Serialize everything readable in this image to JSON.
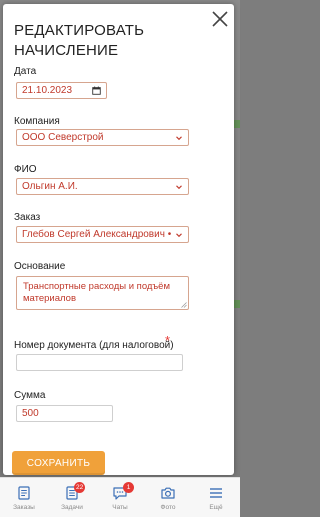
{
  "modal": {
    "title": "РЕДАКТИРОВАТЬ НАЧИСЛЕНИЕ",
    "close_icon": "close-icon"
  },
  "form": {
    "date": {
      "label": "Дата",
      "value": "21.10.2023",
      "icon": "calendar-icon"
    },
    "company": {
      "label": "Компания",
      "value": "ООО Северстрой",
      "icon": "chevron-down-icon"
    },
    "fio": {
      "label": "ФИО",
      "value": "Ольгин А.И.",
      "icon": "chevron-down-icon"
    },
    "order": {
      "label": "Заказ",
      "value": "Глебов Сергей Александрович •",
      "icon": "chevron-down-icon"
    },
    "basis": {
      "label": "Основание",
      "value": "Транспортные расходы и подъём материалов"
    },
    "doc_number": {
      "label": "Номер документа (для налоговой)",
      "required_mark": "*",
      "value": ""
    },
    "amount": {
      "label": "Сумма",
      "value": "500"
    },
    "save_label": "СОХРАНИТЬ"
  },
  "colors": {
    "accent": "#f0a13a",
    "field_border": "#d6a58f",
    "value_text": "#c0392b",
    "badge": "#e53935"
  },
  "bottom_nav": [
    {
      "label": "Заказы",
      "icon": "orders-icon",
      "badge": ""
    },
    {
      "label": "Задачи",
      "icon": "tasks-icon",
      "badge": "22"
    },
    {
      "label": "Чаты",
      "icon": "chat-icon",
      "badge": "1"
    },
    {
      "label": "Фото",
      "icon": "camera-icon",
      "badge": ""
    },
    {
      "label": "Ещё",
      "icon": "menu-icon",
      "badge": ""
    }
  ]
}
